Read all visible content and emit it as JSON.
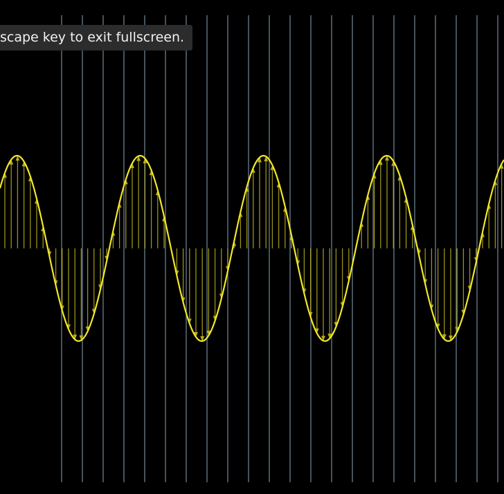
{
  "notification": {
    "message": "scape key to exit fullscreen."
  },
  "colors": {
    "background": "#000000",
    "grid_line": "#8aa3b7",
    "wave": "#f3e829",
    "arrow": "#b5ad1e"
  },
  "icons": [
    "arrow-up-icon",
    "arrow-down-icon"
  ]
}
